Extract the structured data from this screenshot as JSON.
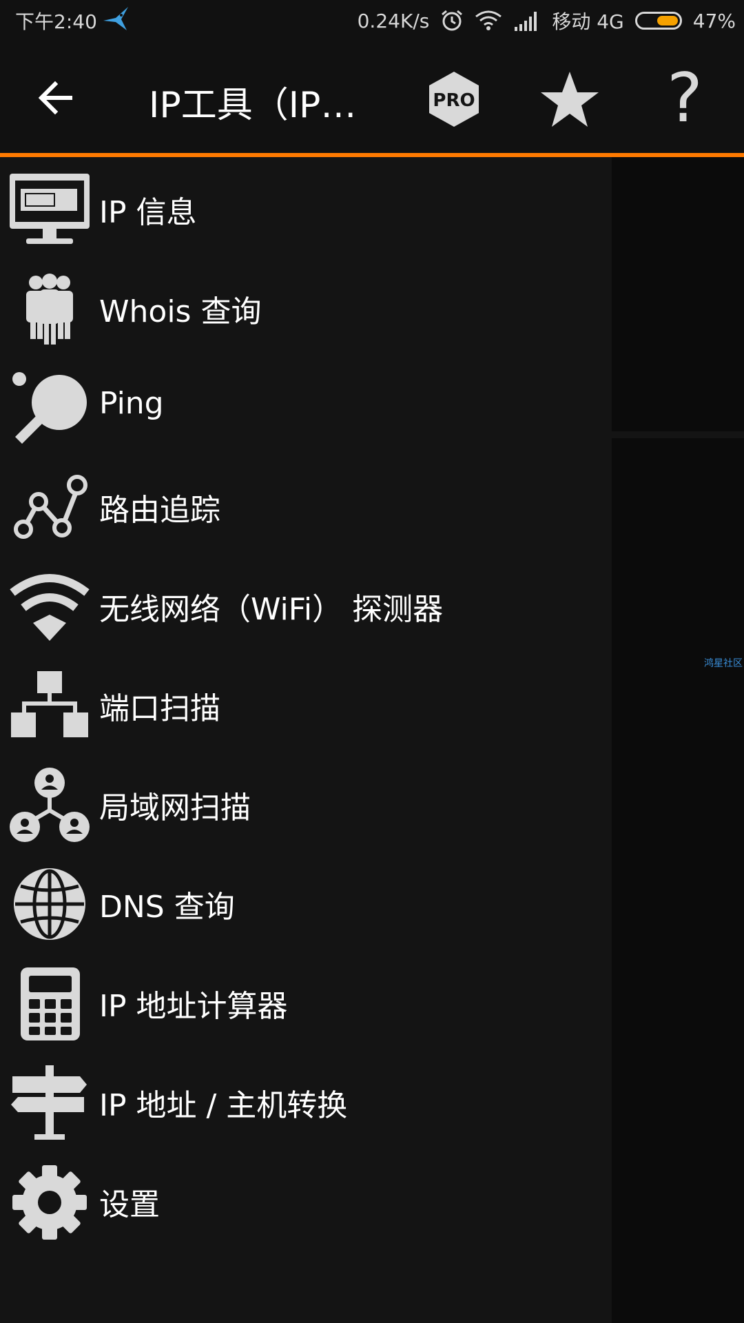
{
  "status_bar": {
    "time": "下午2:40",
    "speed": "0.24K/s",
    "carrier": "移动 4G",
    "battery": "47%",
    "battery_level": 0.47
  },
  "toolbar": {
    "title": "IP工具（IP…",
    "pro_label": "PRO",
    "help_label": "?"
  },
  "menu": {
    "items": [
      {
        "label": "IP 信息",
        "icon": "monitor-icon"
      },
      {
        "label": "Whois 查询",
        "icon": "people-icon"
      },
      {
        "label": "Ping",
        "icon": "ping-pong-icon"
      },
      {
        "label": "路由追踪",
        "icon": "route-icon"
      },
      {
        "label": "无线网络（WiFi） 探测器",
        "icon": "wifi-icon"
      },
      {
        "label": "端口扫描",
        "icon": "hierarchy-icon"
      },
      {
        "label": "局域网扫描",
        "icon": "network-users-icon"
      },
      {
        "label": "DNS 查询",
        "icon": "globe-icon"
      },
      {
        "label": "IP 地址计算器",
        "icon": "calculator-icon"
      },
      {
        "label": "IP 地址 / 主机转换",
        "icon": "signpost-icon"
      },
      {
        "label": "设置",
        "icon": "gear-icon"
      }
    ]
  },
  "watermark": "鸿星社区",
  "colors": {
    "accent": "#ff7a00",
    "background": "#141414",
    "icon": "#d9d9d9"
  }
}
